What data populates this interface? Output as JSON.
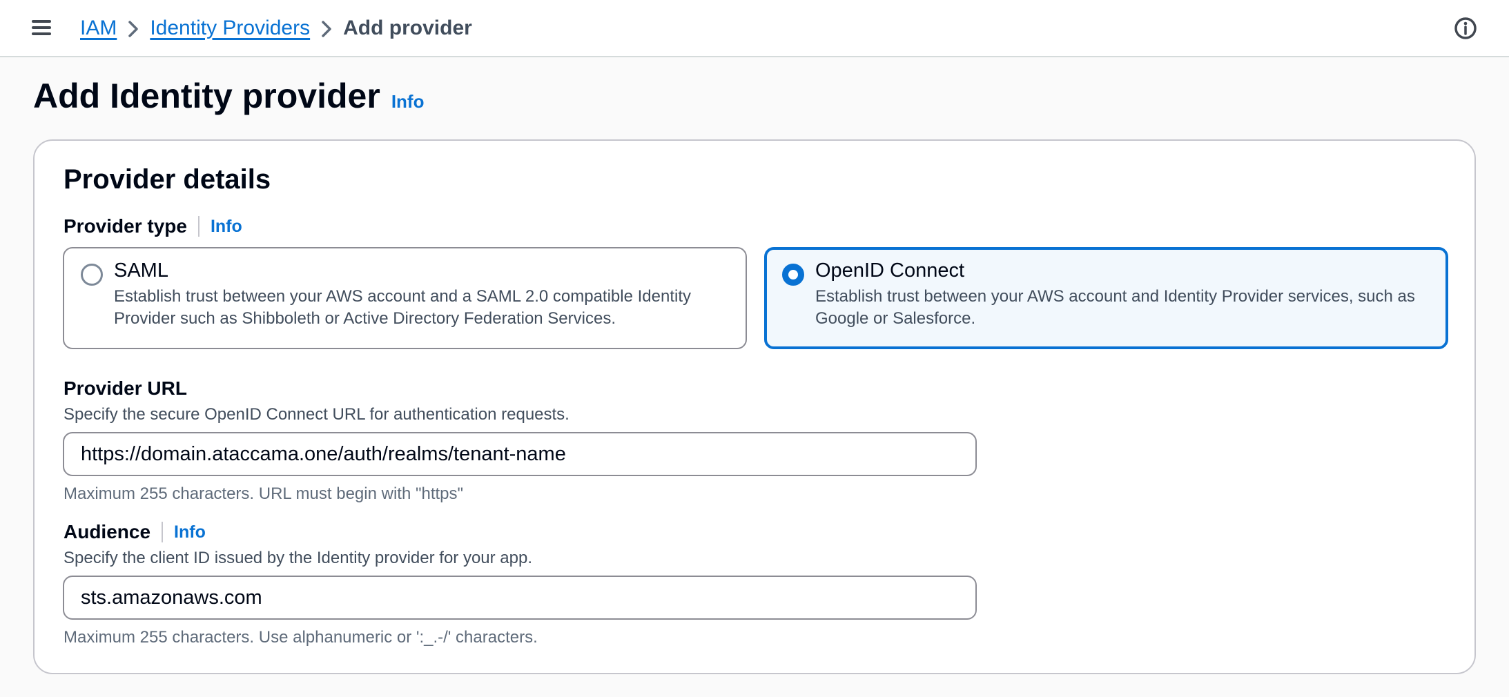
{
  "breadcrumb": {
    "items": [
      "IAM",
      "Identity Providers"
    ],
    "current": "Add provider"
  },
  "icons": {
    "menu": "hamburger-menu-icon",
    "separator": "chevron-right-icon",
    "help": "info-circle-icon"
  },
  "page": {
    "title": "Add Identity provider",
    "info": "Info"
  },
  "provider_details": {
    "title": "Provider details",
    "provider_type": {
      "label": "Provider type",
      "info": "Info",
      "options": [
        {
          "title": "SAML",
          "description": "Establish trust between your AWS account and a SAML 2.0 compatible Identity Provider such as Shibboleth or Active Directory Federation Services.",
          "selected": false
        },
        {
          "title": "OpenID Connect",
          "description": "Establish trust between your AWS account and Identity Provider services, such as Google or Salesforce.",
          "selected": true
        }
      ]
    },
    "provider_url": {
      "label": "Provider URL",
      "description": "Specify the secure OpenID Connect URL for authentication requests.",
      "value": "https://domain.ataccama.one/auth/realms/tenant-name",
      "constraint": "Maximum 255 characters. URL must begin with \"https\""
    },
    "audience": {
      "label": "Audience",
      "info": "Info",
      "description": "Specify the client ID issued by the Identity provider for your app.",
      "value": "sts.amazonaws.com",
      "constraint": "Maximum 255 characters. Use alphanumeric or ':_.-/' characters."
    }
  },
  "colors": {
    "link": "#0972d3",
    "selected_border": "#0972d3",
    "selected_bg": "#f2f8fd",
    "page_bg": "#fafafa"
  }
}
